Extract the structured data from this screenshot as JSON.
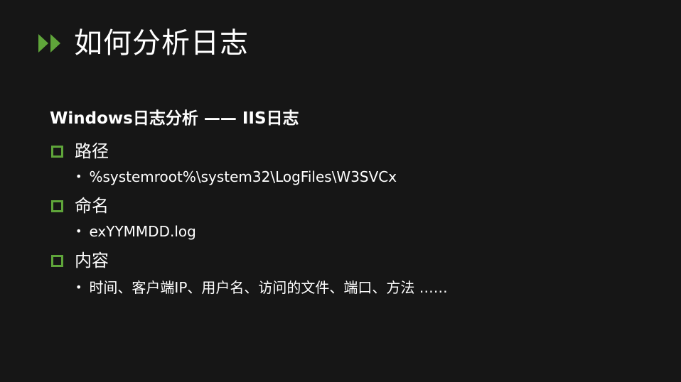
{
  "title": {
    "icon": "double-chevron-right-icon",
    "text": "如何分析日志"
  },
  "subtitle": "Windows日志分析 —— IIS日志",
  "sections": [
    {
      "label": "路径",
      "marker_icon": "hollow-square-bullet-icon",
      "bullet": "%systemroot%\\system32\\LogFiles\\W3SVCx"
    },
    {
      "label": "命名",
      "marker_icon": "hollow-square-bullet-icon",
      "bullet": "exYYMMDD.log"
    },
    {
      "label": "内容",
      "marker_icon": "hollow-square-bullet-icon",
      "bullet": "时间、客户端IP、用户名、访问的文件、端口、方法 ……"
    }
  ],
  "bullet_symbol": "•",
  "colors": {
    "background": "#161616",
    "accent": "#5fa53a",
    "text": "#ffffff"
  }
}
